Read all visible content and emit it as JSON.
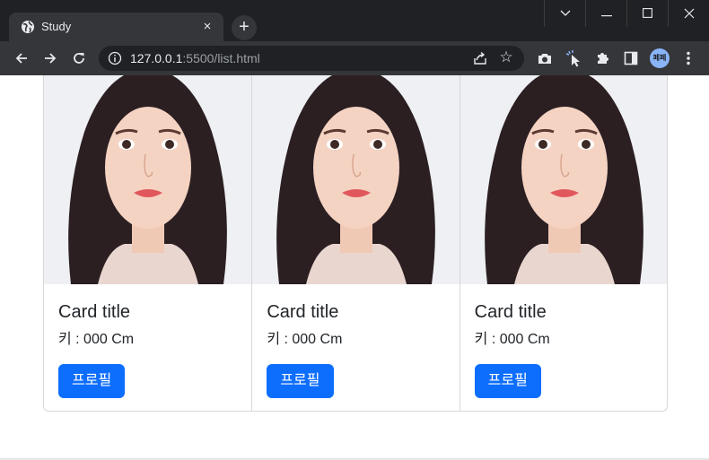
{
  "browser": {
    "tab_title": "Study",
    "tab_close": "×",
    "new_tab": "+",
    "url_host": "127.0.0.1",
    "url_rest": ":5500/list.html",
    "profile_label": "페페",
    "window_controls": [
      "chevron-down",
      "minimize",
      "maximize",
      "close"
    ]
  },
  "cards": [
    {
      "title": "Card title",
      "text": "키 : 000 Cm",
      "button": "프로필"
    },
    {
      "title": "Card title",
      "text": "키 : 000 Cm",
      "button": "프로필"
    },
    {
      "title": "Card title",
      "text": "키 : 000 Cm",
      "button": "프로필"
    }
  ],
  "colors": {
    "button_primary": "#0d6efd",
    "card_border": "#d7d7d7",
    "chrome_dark": "#202124",
    "chrome_toolbar": "#35363a"
  }
}
